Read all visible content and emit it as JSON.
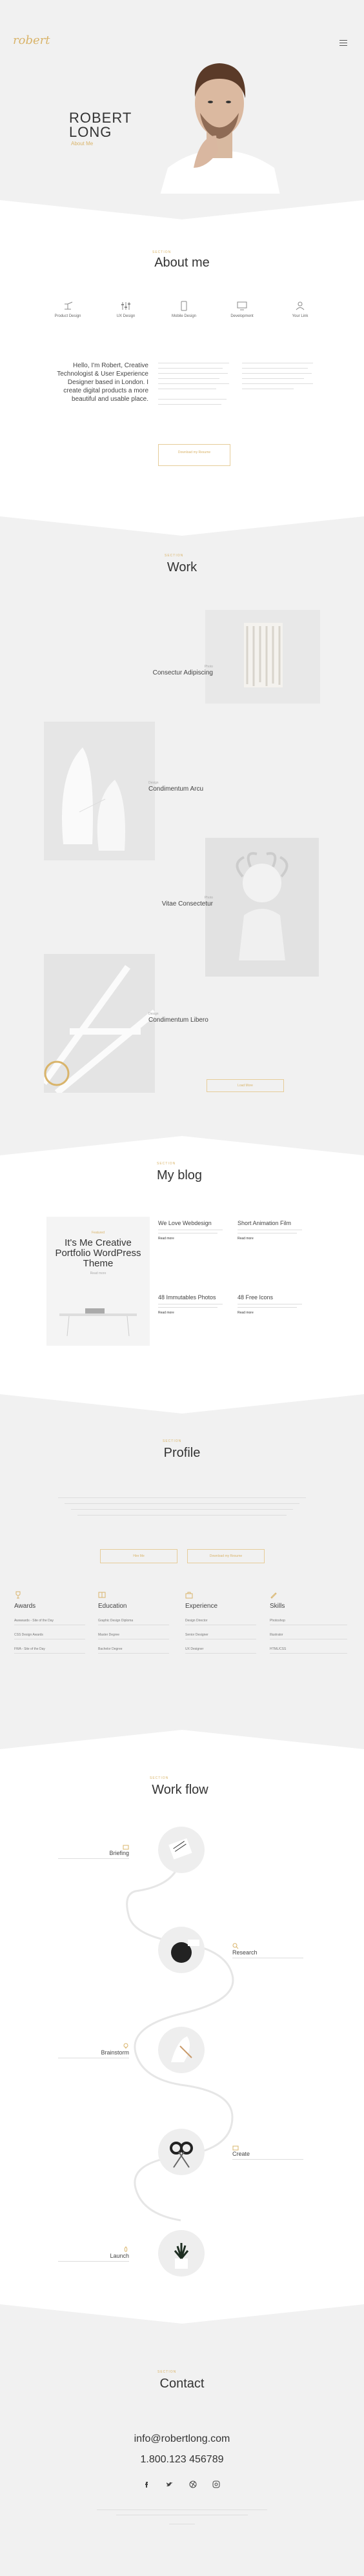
{
  "header": {
    "logo": "robert",
    "menu_icon": "hamburger-menu-icon"
  },
  "hero": {
    "first_name": "ROBERT",
    "last_name": "LONG",
    "about_link": "About Me"
  },
  "about": {
    "kicker": "SECTION",
    "title": "About me",
    "services": [
      {
        "icon": "desk-lamp-icon",
        "label": "Product Design"
      },
      {
        "icon": "sliders-icon",
        "label": "UX Design"
      },
      {
        "icon": "smartphone-icon",
        "label": "Mobile Design"
      },
      {
        "icon": "monitor-icon",
        "label": "Development"
      },
      {
        "icon": "user-icon",
        "label": "Your Link"
      }
    ],
    "intro": "Hello, I'm Robert, Creative Technologist & User Experience Designer based in London. I create digital products a more beautiful and usable place.",
    "button": "Download my Resume"
  },
  "work": {
    "kicker": "SECTION",
    "title": "Work",
    "items": [
      {
        "category": "Photo",
        "title": "Consectur Adipiscing"
      },
      {
        "category": "Design",
        "title": "Condimentum Arcu"
      },
      {
        "category": "Photo",
        "title": "Vitae Consectetur"
      },
      {
        "category": "Design",
        "title": "Condimentum Libero"
      }
    ],
    "load_more": "Load More"
  },
  "blog": {
    "kicker": "SECTION",
    "title": "My blog",
    "featured": {
      "kicker": "Featured",
      "title": "It's Me Creative Portfolio WordPress Theme",
      "link": "Read more"
    },
    "posts": [
      {
        "title": "We Love Webdesign",
        "more": "Read more"
      },
      {
        "title": "Short Animation Film",
        "more": "Read more"
      },
      {
        "title": "48 Immutables Photos",
        "more": "Read more"
      },
      {
        "title": "48 Free Icons",
        "more": "Read more"
      }
    ]
  },
  "profile": {
    "kicker": "SECTION",
    "title": "Profile",
    "buttons": [
      "Hire Me",
      "Download my Resume"
    ],
    "columns": [
      {
        "icon": "trophy-icon",
        "title": "Awards",
        "items": [
          "Awwwards - Site of the Day",
          "CSS Design Awards",
          "FWA - Site of the Day"
        ]
      },
      {
        "icon": "book-icon",
        "title": "Education",
        "items": [
          "Graphic Design Diploma",
          "Master Degree",
          "Bachelor Degree"
        ]
      },
      {
        "icon": "briefcase-icon",
        "title": "Experience",
        "items": [
          "Design Director",
          "Senior Designer",
          "UX Designer"
        ]
      },
      {
        "icon": "pencil-icon",
        "title": "Skills",
        "items": [
          "Photoshop",
          "Illustrator",
          "HTML/CSS"
        ]
      }
    ]
  },
  "workflow": {
    "kicker": "SECTION",
    "title": "Work flow",
    "steps": [
      "Briefing",
      "Research",
      "Brainstorm",
      "Create",
      "Launch"
    ]
  },
  "contact": {
    "kicker": "SECTION",
    "title": "Contact",
    "email": "info@robertlong.com",
    "phone": "1.800.123 456789",
    "social": [
      "facebook-icon",
      "twitter-icon",
      "dribbble-icon",
      "instagram-icon"
    ]
  }
}
